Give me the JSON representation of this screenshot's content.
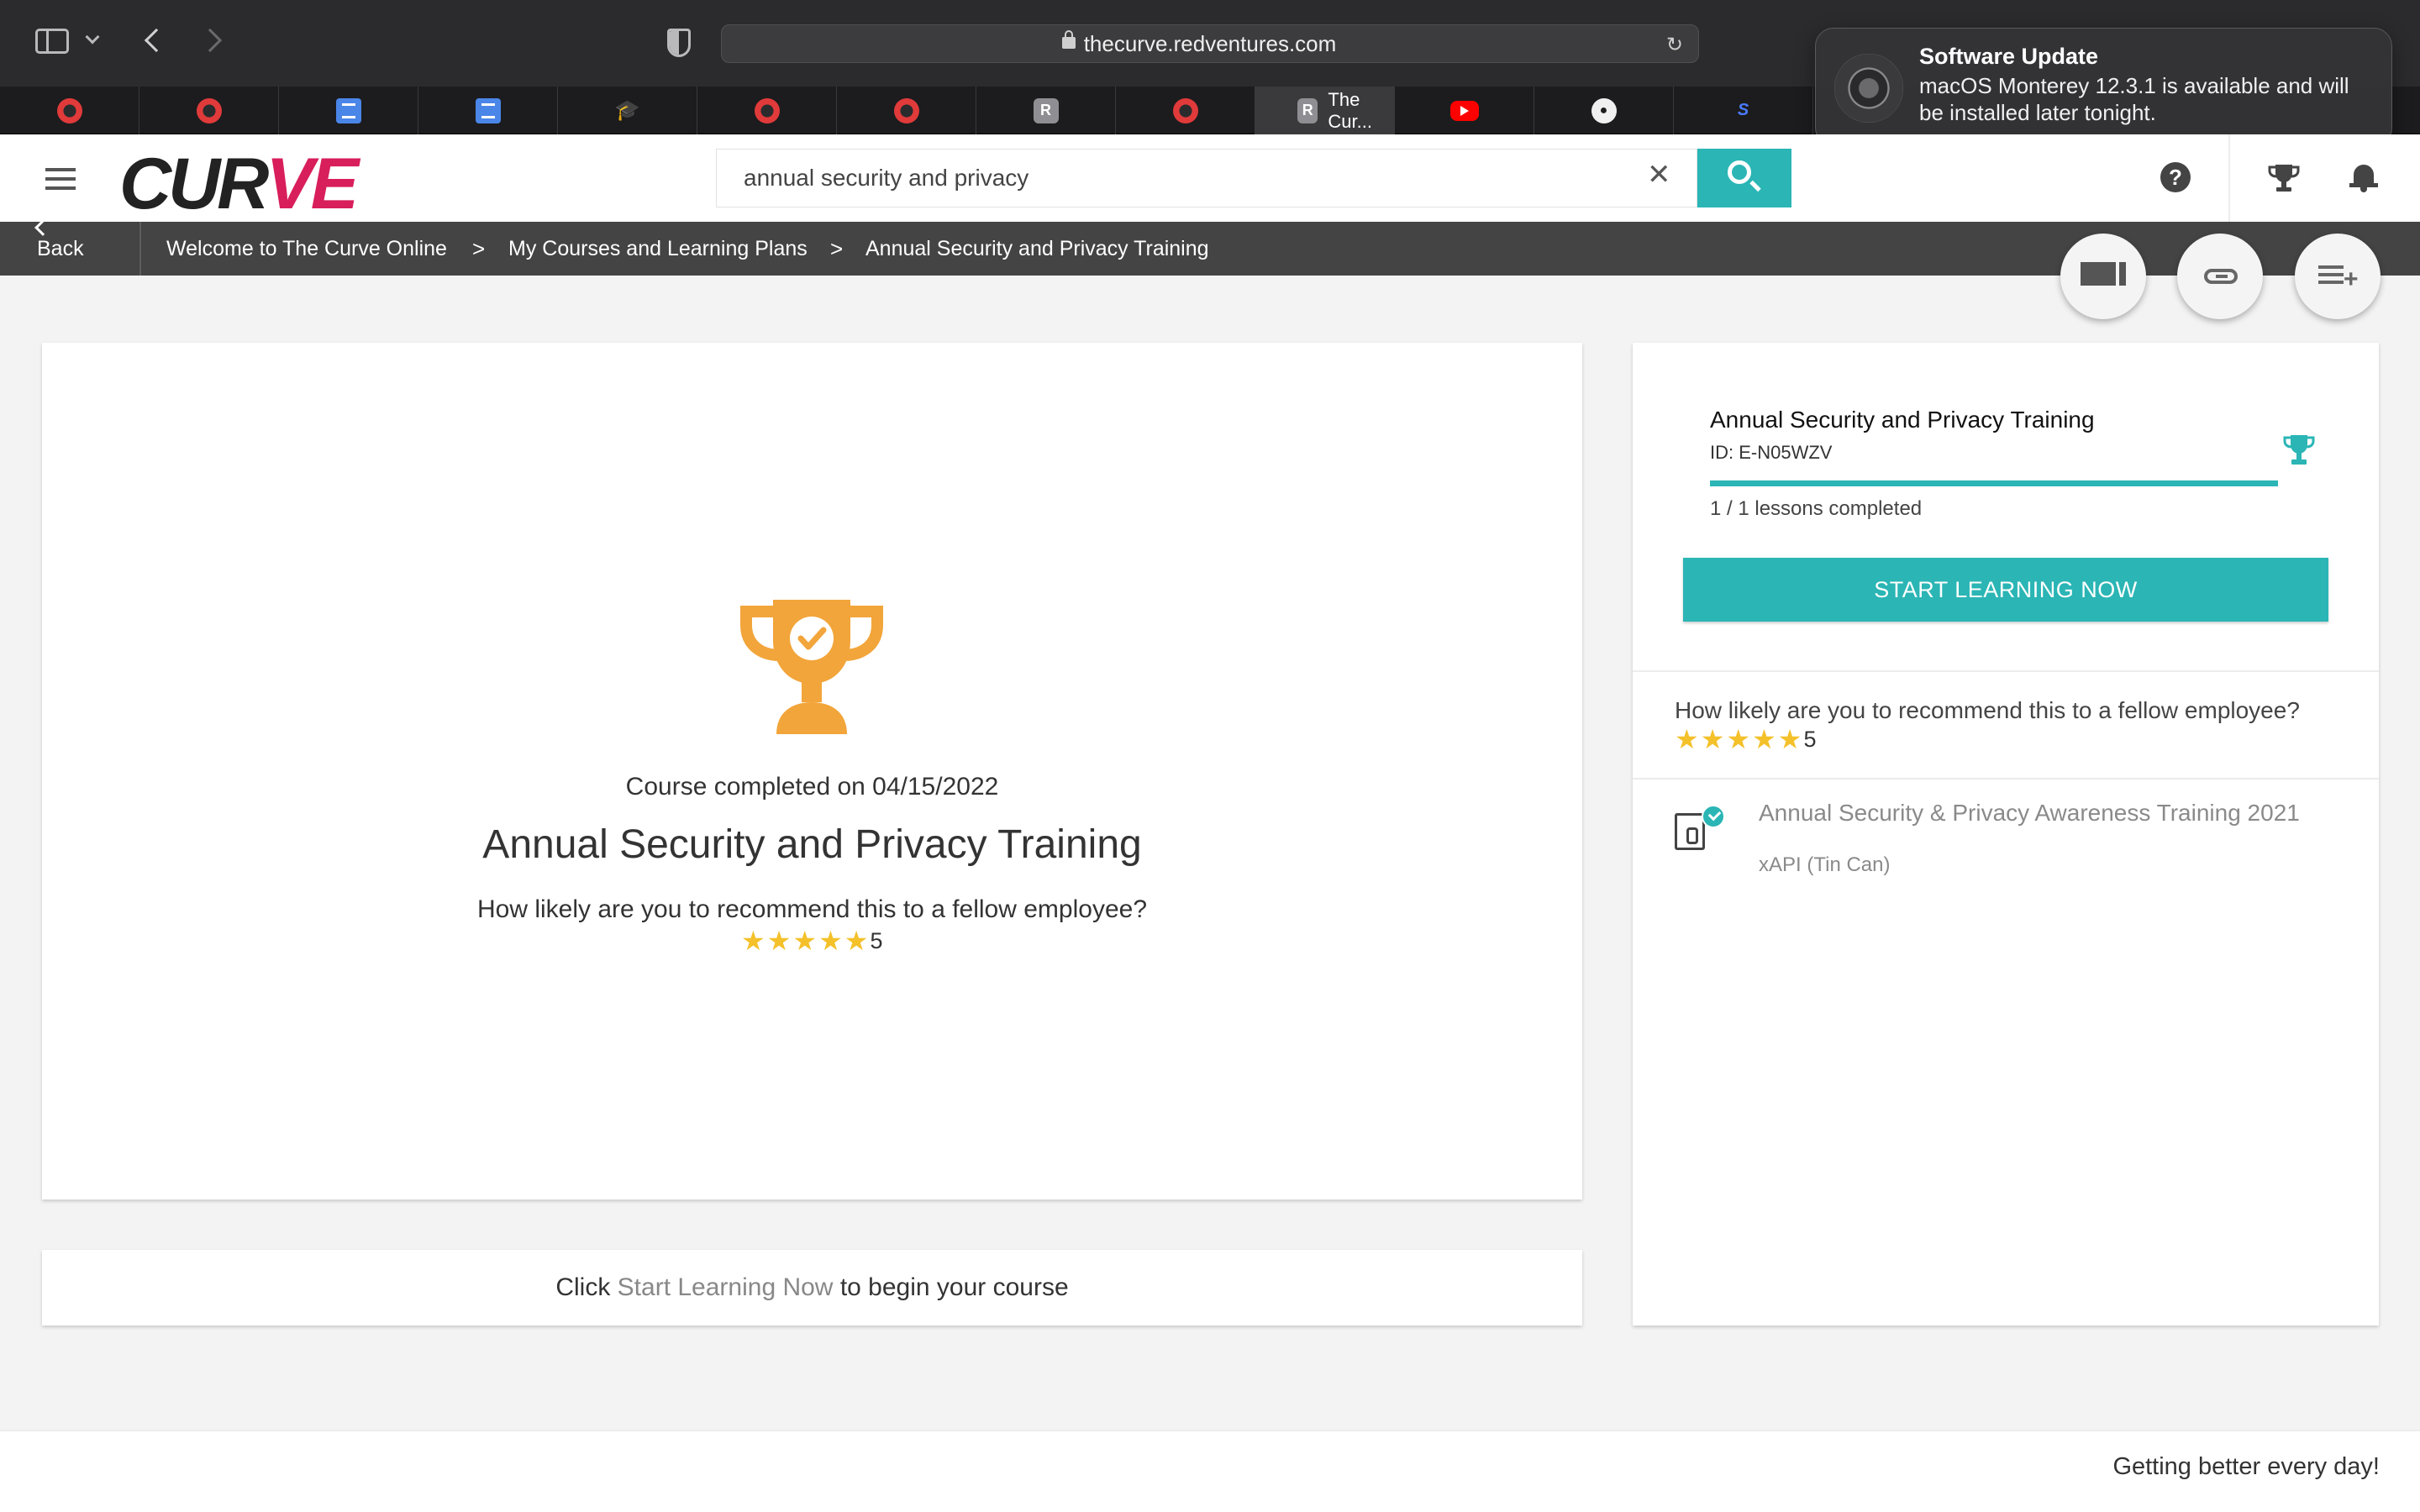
{
  "browser": {
    "url": "thecurve.redventures.com",
    "tabs": [
      {
        "icon": "red-app-icon",
        "label": ""
      },
      {
        "icon": "red-app-icon",
        "label": ""
      },
      {
        "icon": "google-docs-icon",
        "label": ""
      },
      {
        "icon": "google-docs-icon",
        "label": ""
      },
      {
        "icon": "graduation-cap-icon",
        "label": ""
      },
      {
        "icon": "red-app-icon",
        "label": ""
      },
      {
        "icon": "red-app-icon",
        "label": ""
      },
      {
        "icon": "r-app-icon",
        "label": ""
      },
      {
        "icon": "red-app-icon",
        "label": ""
      },
      {
        "icon": "r-app-icon",
        "label": "The Cur..."
      },
      {
        "icon": "youtube-icon",
        "label": ""
      },
      {
        "icon": "github-icon",
        "label": ""
      },
      {
        "icon": "sf-icon",
        "label": ""
      }
    ],
    "active_tab_letter": "R",
    "grey_tab_letter": "R"
  },
  "notification": {
    "title": "Software Update",
    "body": "macOS Monterey 12.3.1 is available and will be installed later tonight."
  },
  "header": {
    "logo_prefix": "CUR",
    "logo_suffix": "VE",
    "search_value": "annual security and privacy",
    "help_label": "?"
  },
  "breadcrumb": {
    "back": "Back",
    "items": [
      "Welcome to The Curve Online",
      "My Courses and Learning Plans",
      "Annual Security and Privacy Training"
    ],
    "separator": ">"
  },
  "main": {
    "completed_on": "Course completed on 04/15/2022",
    "title": "Annual Security and Privacy Training",
    "question": "How likely are you to recommend this to a fellow employee?",
    "rating": 5,
    "rating_text": "5"
  },
  "cta": {
    "prefix": "Click ",
    "highlight": "Start Learning Now",
    "suffix": " to begin your course"
  },
  "sidebar": {
    "title": "Annual Security and Privacy Training",
    "id": "ID: E-N05WZV",
    "progress": 1.0,
    "lessons_completed": "1 / 1 lessons completed",
    "start_button": "START LEARNING NOW",
    "question": "How likely are you to recommend this to a fellow employee?",
    "rating": 5,
    "rating_text": "5",
    "lesson": {
      "name": "Annual Security & Privacy Awareness Training 2021",
      "type": "xAPI (Tin Can)"
    }
  },
  "footer": {
    "tagline": "Getting better every day!"
  },
  "colors": {
    "accent": "#2bb5b5",
    "trophy_orange": "#f2a53a",
    "star_yellow": "#f4c12b",
    "breadcrumb_bg": "#444444"
  }
}
